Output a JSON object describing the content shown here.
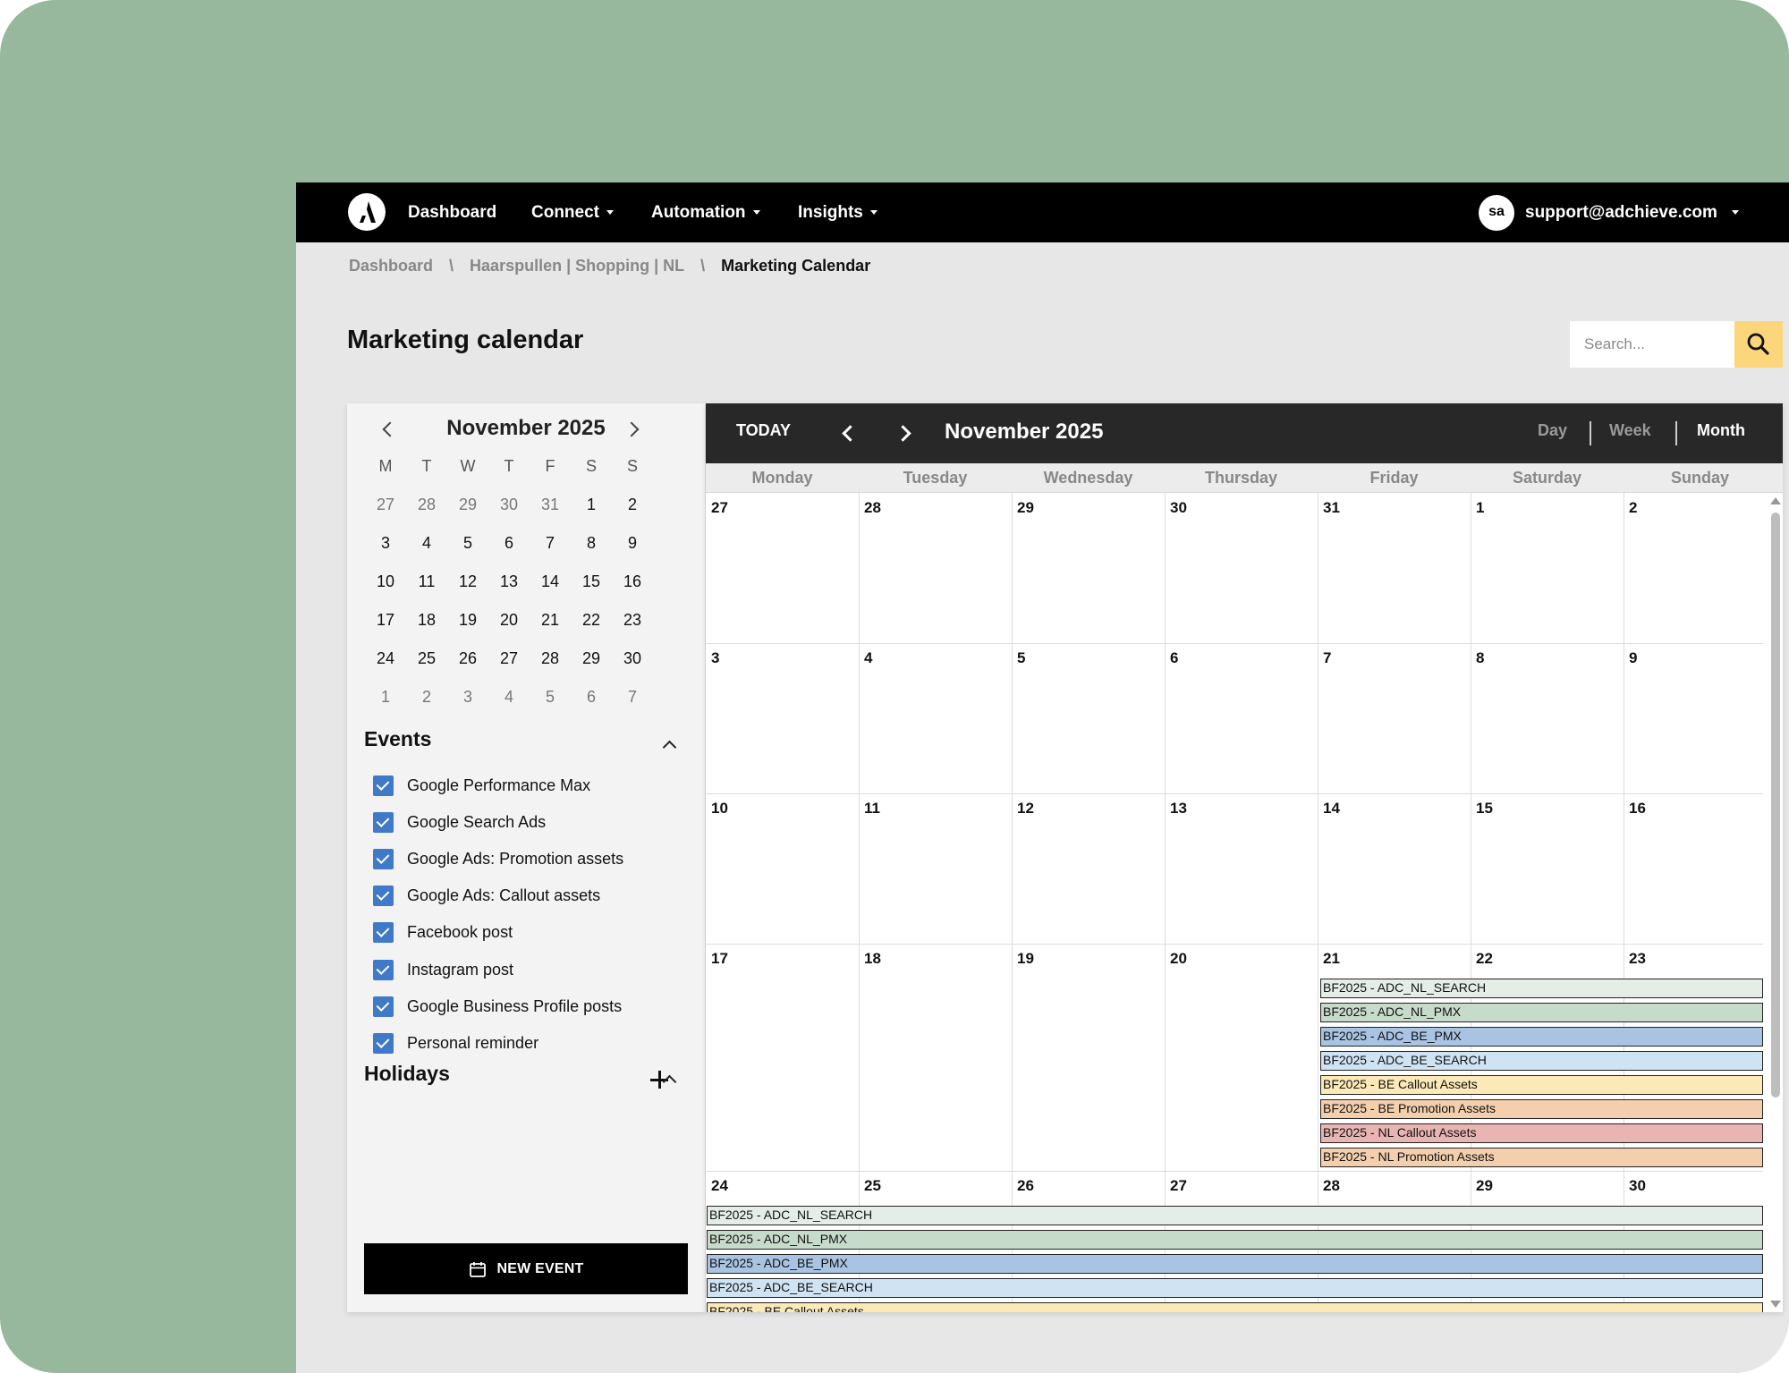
{
  "topnav": {
    "items": [
      {
        "label": "Dashboard",
        "has_caret": false
      },
      {
        "label": "Connect",
        "has_caret": true
      },
      {
        "label": "Automation",
        "has_caret": true
      },
      {
        "label": "Insights",
        "has_caret": true
      }
    ],
    "user": {
      "initials": "sa",
      "email": "support@adchieve.com"
    }
  },
  "breadcrumb": [
    "Dashboard",
    "Haarspullen | Shopping | NL",
    "Marketing Calendar"
  ],
  "page_title": "Marketing calendar",
  "search": {
    "placeholder": "Search..."
  },
  "mini_calendar": {
    "title": "November 2025",
    "weekdays": [
      "M",
      "T",
      "W",
      "T",
      "F",
      "S",
      "S"
    ],
    "weeks": [
      [
        "27",
        "28",
        "29",
        "30",
        "31",
        "1",
        "2"
      ],
      [
        "3",
        "4",
        "5",
        "6",
        "7",
        "8",
        "9"
      ],
      [
        "10",
        "11",
        "12",
        "13",
        "14",
        "15",
        "16"
      ],
      [
        "17",
        "18",
        "19",
        "20",
        "21",
        "22",
        "23"
      ],
      [
        "24",
        "25",
        "26",
        "27",
        "28",
        "29",
        "30"
      ],
      [
        "1",
        "2",
        "3",
        "4",
        "5",
        "6",
        "7"
      ]
    ]
  },
  "events_section": {
    "title": "Events",
    "filters": [
      {
        "label": "Google Performance Max",
        "checked": true
      },
      {
        "label": "Google Search Ads",
        "checked": true
      },
      {
        "label": "Google Ads: Promotion assets",
        "checked": true
      },
      {
        "label": "Google Ads: Callout assets",
        "checked": true
      },
      {
        "label": "Facebook post",
        "checked": true
      },
      {
        "label": "Instagram post",
        "checked": true
      },
      {
        "label": "Google Business Profile posts",
        "checked": true
      },
      {
        "label": "Personal reminder",
        "checked": true
      }
    ]
  },
  "holidays_section": {
    "title": "Holidays"
  },
  "new_event_label": "NEW EVENT",
  "calendar": {
    "today_label": "TODAY",
    "title": "November 2025",
    "views": [
      "Day",
      "Week",
      "Month"
    ],
    "active_view": "Month",
    "weekdays": [
      "Monday",
      "Tuesday",
      "Wednesday",
      "Thursday",
      "Friday",
      "Saturday",
      "Sunday"
    ],
    "weeks": [
      [
        "27",
        "28",
        "29",
        "30",
        "31",
        "1",
        "2"
      ],
      [
        "3",
        "4",
        "5",
        "6",
        "7",
        "8",
        "9"
      ],
      [
        "10",
        "11",
        "12",
        "13",
        "14",
        "15",
        "16"
      ],
      [
        "17",
        "18",
        "19",
        "20",
        "21",
        "22",
        "23"
      ],
      [
        "24",
        "25",
        "26",
        "27",
        "28",
        "29",
        "30"
      ]
    ],
    "events": [
      {
        "title": "BF2025 - ADC_NL_SEARCH",
        "color": "#e4ede6"
      },
      {
        "title": "BF2025 - ADC_NL_PMX",
        "color": "#c7dbcb"
      },
      {
        "title": "BF2025 - ADC_BE_PMX",
        "color": "#a9c4e2"
      },
      {
        "title": "BF2025 - ADC_BE_SEARCH",
        "color": "#cfe3f3"
      },
      {
        "title": "BF2025 - BE Callout Assets",
        "color": "#fbe9b7"
      },
      {
        "title": "BF2025 - BE Promotion Assets",
        "color": "#f4cfae"
      },
      {
        "title": "BF2025 - NL Callout Assets",
        "color": "#e9b5b3"
      },
      {
        "title": "BF2025 - NL Promotion Assets",
        "color": "#f4cfae"
      }
    ]
  }
}
